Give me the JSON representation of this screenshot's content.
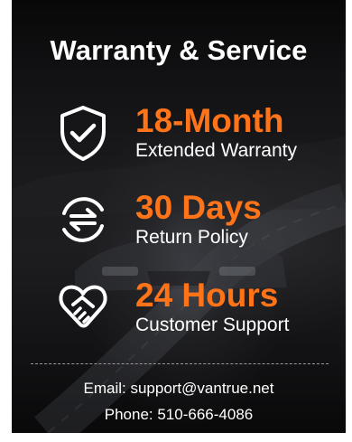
{
  "title": "Warranty & Service",
  "features": [
    {
      "headline": "18-Month",
      "subline": "Extended Warranty",
      "icon": "shield-check-icon"
    },
    {
      "headline": "30 Days",
      "subline": "Return Policy",
      "icon": "return-arrows-icon"
    },
    {
      "headline": "24 Hours",
      "subline": "Customer Support",
      "icon": "handshake-heart-icon"
    }
  ],
  "contact": {
    "email_line": "Email: support@vantrue.net",
    "phone_line": "Phone: 510-666-4086"
  },
  "colors": {
    "accent": "#ff7419",
    "text": "#ffffff",
    "background": "#0f0f10"
  }
}
